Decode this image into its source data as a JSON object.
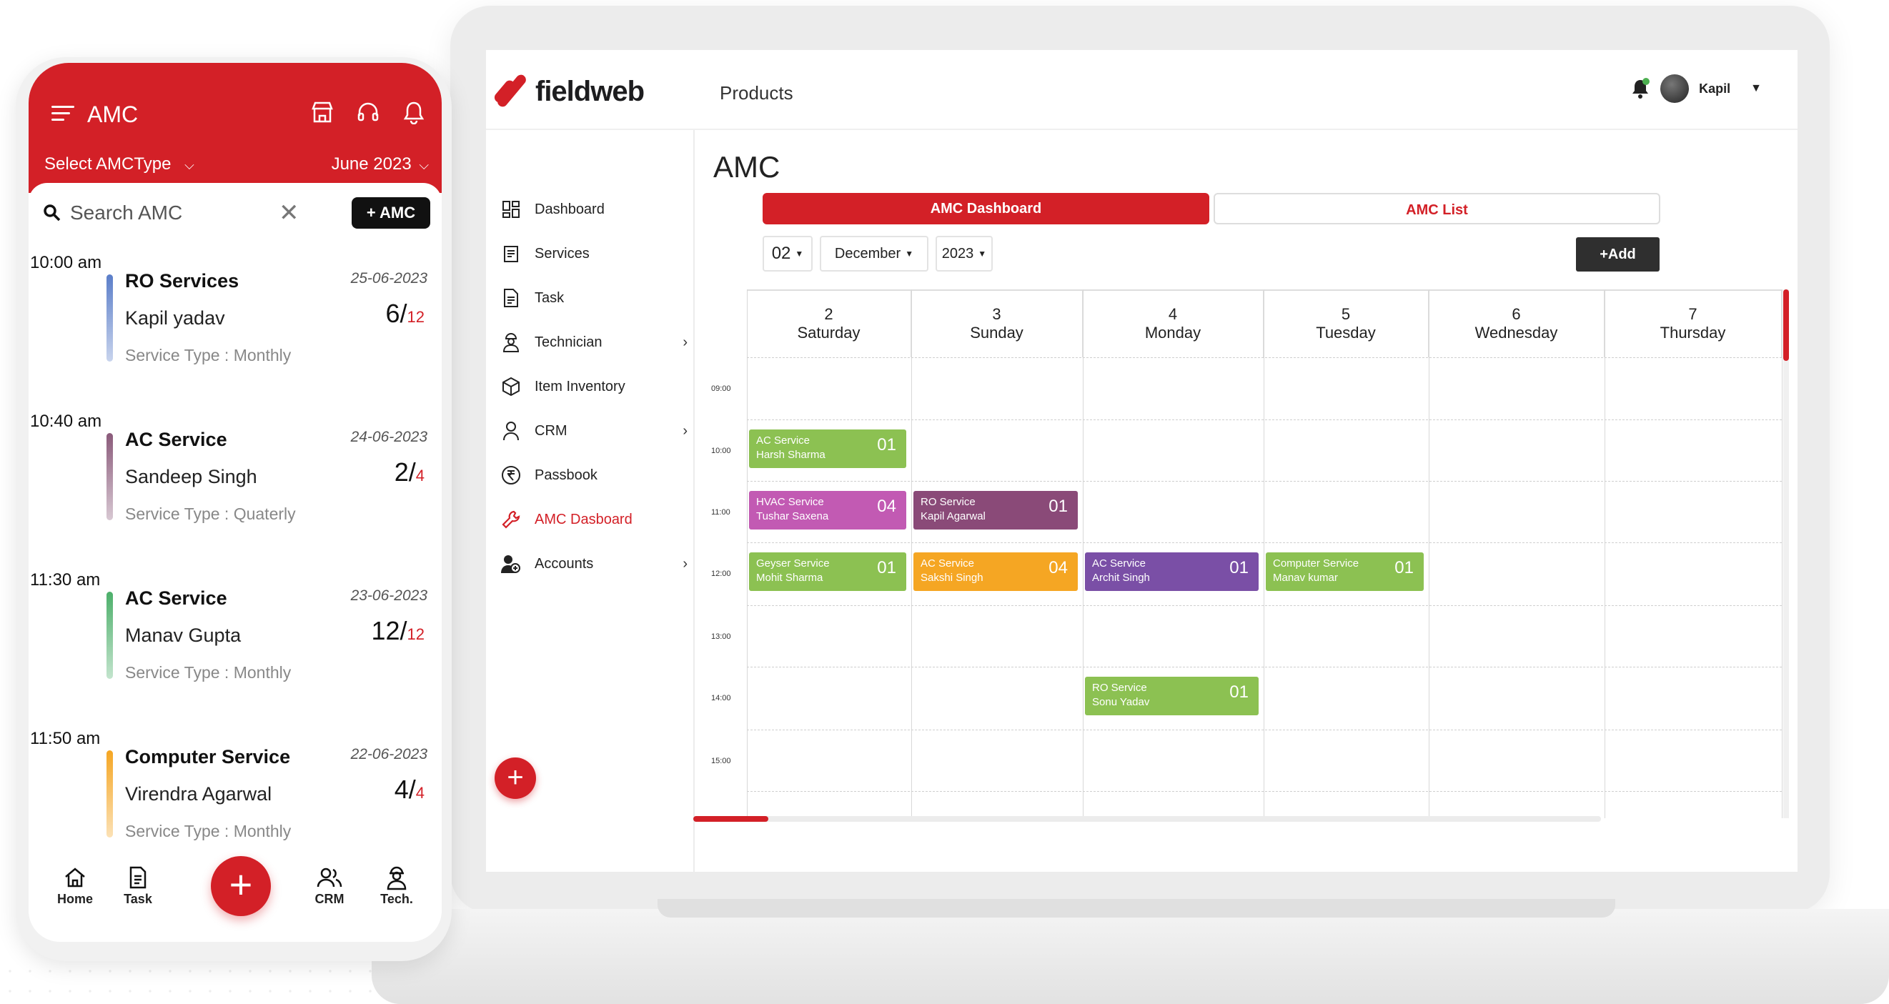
{
  "laptop": {
    "brand": "fieldweb",
    "header_title": "Products",
    "user_name": "Kapil",
    "sidebar": [
      {
        "label": "Dashboard",
        "icon": "dashboard-icon",
        "arrow": ""
      },
      {
        "label": "Services",
        "icon": "services-icon",
        "arrow": ""
      },
      {
        "label": "Task",
        "icon": "task-icon",
        "arrow": ""
      },
      {
        "label": "Technician",
        "icon": "technician-icon",
        "arrow": "›"
      },
      {
        "label": "Item Inventory",
        "icon": "box-icon",
        "arrow": ""
      },
      {
        "label": "CRM",
        "icon": "person-icon",
        "arrow": "›"
      },
      {
        "label": "Passbook",
        "icon": "rupee-icon",
        "arrow": ""
      },
      {
        "label": "AMC Dasboard",
        "icon": "wrench-icon",
        "arrow": "",
        "active": true
      },
      {
        "label": "Accounts",
        "icon": "accounts-icon",
        "arrow": "›"
      }
    ],
    "fab": "+",
    "main_title": "AMC",
    "tabs": {
      "dashboard": "AMC Dashboard",
      "list": "AMC List"
    },
    "filters": {
      "day": "02",
      "month": "December",
      "year": "2023"
    },
    "add_label": "+Add",
    "calendar": {
      "days": [
        {
          "num": "2",
          "name": "Saturday"
        },
        {
          "num": "3",
          "name": "Sunday"
        },
        {
          "num": "4",
          "name": "Monday"
        },
        {
          "num": "5",
          "name": "Tuesday"
        },
        {
          "num": "6",
          "name": "Wednesday"
        },
        {
          "num": "7",
          "name": "Thursday"
        }
      ],
      "times": [
        "09:00",
        "10:00",
        "11:00",
        "12:00",
        "13:00",
        "14:00",
        "15:00"
      ],
      "events": [
        {
          "title": "AC Service",
          "person": "Harsh Sharma",
          "count": "01",
          "day": 0,
          "slot": 1,
          "color": "#8cc152"
        },
        {
          "title": "HVAC Service",
          "person": "Tushar Saxena",
          "count": "04",
          "day": 0,
          "slot": 2,
          "color": "#c25ab3"
        },
        {
          "title": "RO Service",
          "person": "Kapil Agarwal",
          "count": "01",
          "day": 1,
          "slot": 2,
          "color": "#8a4a78"
        },
        {
          "title": "Geyser Service",
          "person": "Mohit Sharma",
          "count": "01",
          "day": 0,
          "slot": 3,
          "color": "#8cc152"
        },
        {
          "title": "AC Service",
          "person": "Sakshi Singh",
          "count": "04",
          "day": 1,
          "slot": 3,
          "color": "#f5a623"
        },
        {
          "title": "AC Service",
          "person": "Archit Singh",
          "count": "01",
          "day": 2,
          "slot": 3,
          "color": "#7a4fa6"
        },
        {
          "title": "Computer Service",
          "person": "Manav kumar",
          "count": "01",
          "day": 3,
          "slot": 3,
          "color": "#8cc152"
        },
        {
          "title": "RO Service",
          "person": "Sonu Yadav",
          "count": "01",
          "day": 2,
          "slot": 5,
          "color": "#8cc152"
        }
      ]
    }
  },
  "phone": {
    "title": "AMC",
    "select_type": "Select AMCType",
    "month": "June 2023",
    "search_placeholder": "Search AMC",
    "add_label": "+ AMC",
    "items": [
      {
        "time": "10:00 am",
        "service": "RO Services",
        "customer": "Kapil yadav",
        "type": "Service Type : Monthly",
        "date": "25-06-2023",
        "done": "6",
        "total": "12",
        "color": "#5b7ec9"
      },
      {
        "time": "10:40 am",
        "service": "AC Service",
        "customer": "Sandeep Singh",
        "type": "Service Type : Quaterly",
        "date": "24-06-2023",
        "done": "2",
        "total": "4",
        "color": "#8a5a7a"
      },
      {
        "time": "11:30 am",
        "service": "AC Service",
        "customer": "Manav Gupta",
        "type": "Service Type : Monthly",
        "date": "23-06-2023",
        "done": "12",
        "total": "12",
        "color": "#4caf6a"
      },
      {
        "time": "11:50 am",
        "service": "Computer Service",
        "customer": "Virendra Agarwal",
        "type": "Service Type : Monthly",
        "date": "22-06-2023",
        "done": "4",
        "total": "4",
        "color": "#f5a623"
      }
    ],
    "nav": {
      "home": "Home",
      "task": "Task",
      "crm": "CRM",
      "tech": "Tech."
    },
    "fab": "+"
  }
}
